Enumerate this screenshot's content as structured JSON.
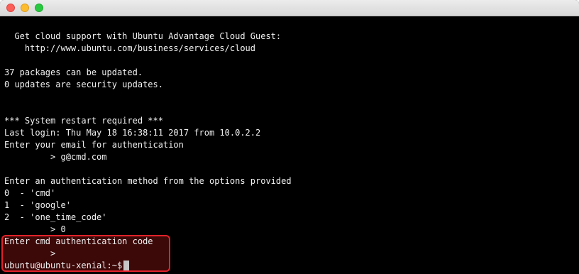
{
  "window": {
    "title": ""
  },
  "terminal": {
    "lines": [
      "  Get cloud support with Ubuntu Advantage Cloud Guest:",
      "    http://www.ubuntu.com/business/services/cloud",
      "",
      "37 packages can be updated.",
      "0 updates are security updates.",
      "",
      "",
      "",
      "*** System restart required ***",
      "Last login: Thu May 18 16:38:11 2017 from 10.0.2.2",
      "Enter your email for authentication",
      "         > g@cmd.com",
      "",
      "Enter an authentication method from the options provided",
      "0  - 'cmd'",
      "1  - 'google'",
      "2  - 'one_time_code'",
      "         > 0",
      "Enter cmd authentication code",
      "         >",
      "ubuntu@ubuntu-xenial:~$ "
    ]
  },
  "colors": {
    "background": "#000000",
    "text": "#f2f2f2",
    "highlight_border": "#e1222a"
  }
}
